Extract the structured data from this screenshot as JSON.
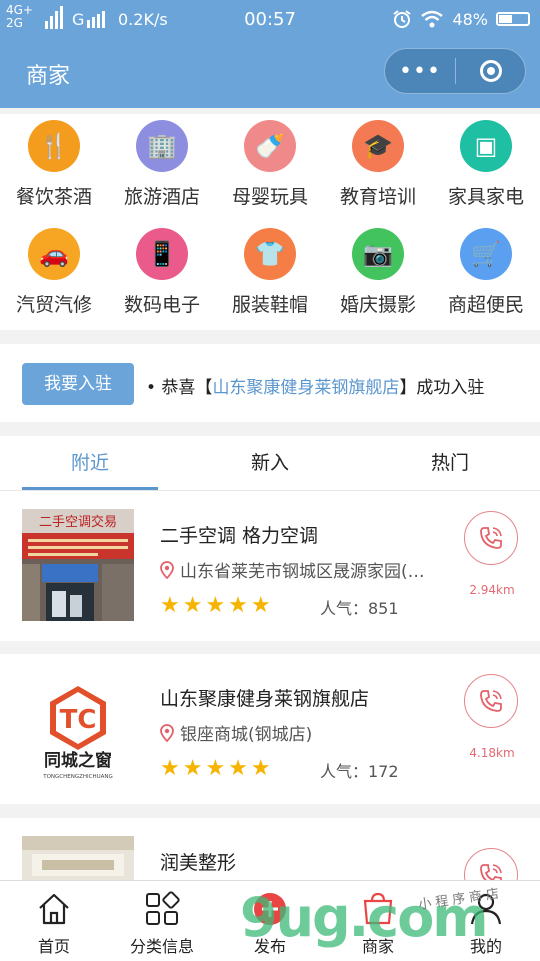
{
  "status_bar": {
    "signal_top": "4G+",
    "signal_bottom": "2G",
    "signal_g": "G",
    "speed": "0.2K/s",
    "time": "00:57",
    "battery": "48%",
    "battery_level": 0.48
  },
  "nav": {
    "title": "商家",
    "more_glyph": "•••"
  },
  "categories": [
    {
      "label": "餐饮茶酒",
      "icon": "fork-knife-icon",
      "color": "#f39c1e",
      "glyph": "🍴"
    },
    {
      "label": "旅游酒店",
      "icon": "building-icon",
      "color": "#8e8ee0",
      "glyph": "🏢"
    },
    {
      "label": "母婴玩具",
      "icon": "baby-bottle-icon",
      "color": "#f08a8a",
      "glyph": "🍼"
    },
    {
      "label": "教育培训",
      "icon": "graduation-cap-icon",
      "color": "#f37a52",
      "glyph": "🎓"
    },
    {
      "label": "家具家电",
      "icon": "furniture-icon",
      "color": "#1fbfa3",
      "glyph": "▣"
    },
    {
      "label": "汽贸汽修",
      "icon": "car-icon",
      "color": "#f6a623",
      "glyph": "🚗"
    },
    {
      "label": "数码电子",
      "icon": "mobile-phone-icon",
      "color": "#ea5a8a",
      "glyph": "📱"
    },
    {
      "label": "服装鞋帽",
      "icon": "tshirt-icon",
      "color": "#f57e47",
      "glyph": "👕"
    },
    {
      "label": "婚庆摄影",
      "icon": "camera-icon",
      "color": "#43c35e",
      "glyph": "📷"
    },
    {
      "label": "商超便民",
      "icon": "shopping-cart-icon",
      "color": "#5b9ff0",
      "glyph": "🛒"
    }
  ],
  "notice": {
    "join_button": "我要入驻",
    "prefix": "• 恭喜【",
    "shop": "山东聚康健身莱钢旗舰店",
    "suffix": "】成功入驻"
  },
  "tabs": [
    "附近",
    "新入",
    "热门"
  ],
  "shops": [
    {
      "name": "二手空调 格力空调",
      "address": "山东省莱芜市钢城区晟源家园(…",
      "stars": "★★★★★",
      "popularity": "人气：851",
      "distance": "2.94km",
      "thumb_text": "二手空调交易"
    },
    {
      "name": "山东聚康健身莱钢旗舰店",
      "address": "银座商城(钢城店)",
      "stars": "★★★★★",
      "popularity": "人气：172",
      "distance": "4.18km",
      "logo_main": "同城之窗",
      "logo_sub": "TONGCHENGZHICHUANG",
      "logo_mark": "TC"
    },
    {
      "name": "润美整形"
    }
  ],
  "tabbar": [
    {
      "label": "首页",
      "icon": "home-icon"
    },
    {
      "label": "分类信息",
      "icon": "category-grid-icon"
    },
    {
      "label": "发布",
      "icon": "publish-plus-icon"
    },
    {
      "label": "商家",
      "icon": "shop-icon"
    },
    {
      "label": "我的",
      "icon": "user-icon"
    }
  ],
  "watermark": {
    "big": "9ug.com",
    "small": "小程序商店"
  }
}
